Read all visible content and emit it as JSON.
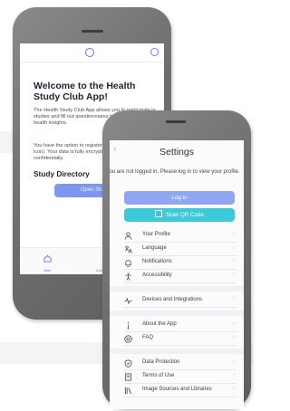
{
  "home": {
    "title": "Welcome to the Health Study Club App!",
    "paragraph1": "The Health Study Club App allows you to participate in studies and fill out questionnaires to improve your health insights.",
    "paragraph2": "You have the option to register in the settings (gear icon). Your data is fully encrypted and treated confidentially.",
    "directory_heading": "Study Directory",
    "directory_button": "Open Study Directory",
    "nav": [
      {
        "label": "Start",
        "icon": "home-icon"
      },
      {
        "label": "Data Protection",
        "icon": "lock-icon"
      }
    ]
  },
  "settings": {
    "title": "Settings",
    "notice": "You are not logged in. Please log in to view your profile.",
    "login_button": "Log In",
    "scan_button": "Scan QR Code",
    "items": [
      {
        "label": "Your Profile",
        "icon": "user-icon"
      },
      {
        "label": "Language",
        "icon": "translate-icon"
      },
      {
        "label": "Notifications",
        "icon": "bell-icon"
      },
      {
        "label": "Accessibility",
        "icon": "accessibility-icon"
      },
      {
        "label": "Devices and Integrations",
        "icon": "pulse-icon"
      },
      {
        "label": "About the App",
        "icon": "info-icon"
      },
      {
        "label": "FAQ",
        "icon": "help-icon"
      },
      {
        "label": "Data Protection",
        "icon": "shield-icon"
      },
      {
        "label": "Terms of Use",
        "icon": "document-icon"
      },
      {
        "label": "Image Sources and Libraries",
        "icon": "library-icon"
      }
    ],
    "chevron": "›"
  },
  "colors": {
    "accent": "#7d97ee",
    "login": "#8fa6f0",
    "scan": "#3cc9d9",
    "frame": "#6f6f6f"
  }
}
